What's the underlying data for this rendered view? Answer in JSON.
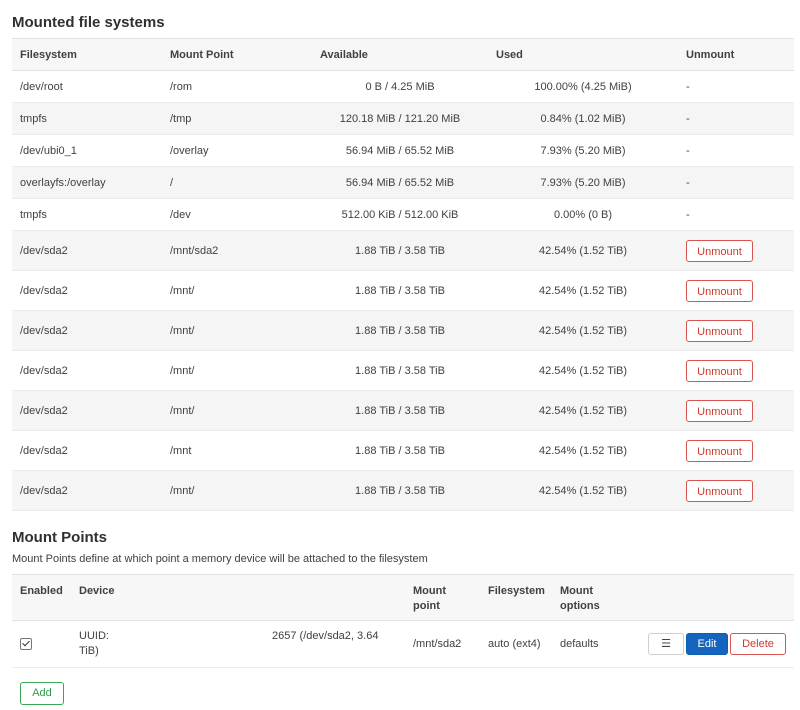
{
  "mounted": {
    "title": "Mounted file systems",
    "headers": [
      "Filesystem",
      "Mount Point",
      "Available",
      "Used",
      "Unmount"
    ],
    "rows": [
      {
        "fs": "/dev/root",
        "mount": "/rom",
        "available": "0 B / 4.25 MiB",
        "used": "100.00% (4.25 MiB)",
        "unmount": "-"
      },
      {
        "fs": "tmpfs",
        "mount": "/tmp",
        "available": "120.18 MiB / 121.20 MiB",
        "used": "0.84% (1.02 MiB)",
        "unmount": "-"
      },
      {
        "fs": "/dev/ubi0_1",
        "mount": "/overlay",
        "available": "56.94 MiB / 65.52 MiB",
        "used": "7.93% (5.20 MiB)",
        "unmount": "-"
      },
      {
        "fs": "overlayfs:/overlay",
        "mount": "/",
        "available": "56.94 MiB / 65.52 MiB",
        "used": "7.93% (5.20 MiB)",
        "unmount": "-"
      },
      {
        "fs": "tmpfs",
        "mount": "/dev",
        "available": "512.00 KiB / 512.00 KiB",
        "used": "0.00% (0 B)",
        "unmount": "-"
      },
      {
        "fs": "/dev/sda2",
        "mount": "/mnt/sda2",
        "available": "1.88 TiB / 3.58 TiB",
        "used": "42.54% (1.52 TiB)",
        "unmount": "Unmount"
      },
      {
        "fs": "/dev/sda2",
        "mount": "/mnt/",
        "available": "1.88 TiB / 3.58 TiB",
        "used": "42.54% (1.52 TiB)",
        "unmount": "Unmount"
      },
      {
        "fs": "/dev/sda2",
        "mount": "/mnt/",
        "available": "1.88 TiB / 3.58 TiB",
        "used": "42.54% (1.52 TiB)",
        "unmount": "Unmount"
      },
      {
        "fs": "/dev/sda2",
        "mount": "/mnt/",
        "available": "1.88 TiB / 3.58 TiB",
        "used": "42.54% (1.52 TiB)",
        "unmount": "Unmount"
      },
      {
        "fs": "/dev/sda2",
        "mount": "/mnt/",
        "available": "1.88 TiB / 3.58 TiB",
        "used": "42.54% (1.52 TiB)",
        "unmount": "Unmount"
      },
      {
        "fs": "/dev/sda2",
        "mount": "/mnt",
        "available": "1.88 TiB / 3.58 TiB",
        "used": "42.54% (1.52 TiB)",
        "unmount": "Unmount"
      },
      {
        "fs": "/dev/sda2",
        "mount": "/mnt/",
        "available": "1.88 TiB / 3.58 TiB",
        "used": "42.54% (1.52 TiB)",
        "unmount": "Unmount"
      }
    ]
  },
  "mount_points": {
    "title": "Mount Points",
    "description": "Mount Points define at which point a memory device will be attached to the filesystem",
    "headers": {
      "enabled": "Enabled",
      "device": "Device",
      "mount_point_1": "Mount",
      "mount_point_2": "point",
      "filesystem": "Filesystem",
      "options_1": "Mount",
      "options_2": "options"
    },
    "row": {
      "enabled": true,
      "device_prefix": "UUID:",
      "device_suffix": "2657",
      "device_rest": " (/dev/sda2, 3.64",
      "device_line2": "TiB)",
      "mount_point": "/mnt/sda2",
      "filesystem": "auto (ext4)",
      "options": "defaults",
      "menu_label": "☰",
      "edit_label": "Edit",
      "delete_label": "Delete"
    },
    "add_label": "Add"
  },
  "colors": {
    "danger": "#d9534f",
    "primary": "#1565c0",
    "success": "#3aa757"
  }
}
